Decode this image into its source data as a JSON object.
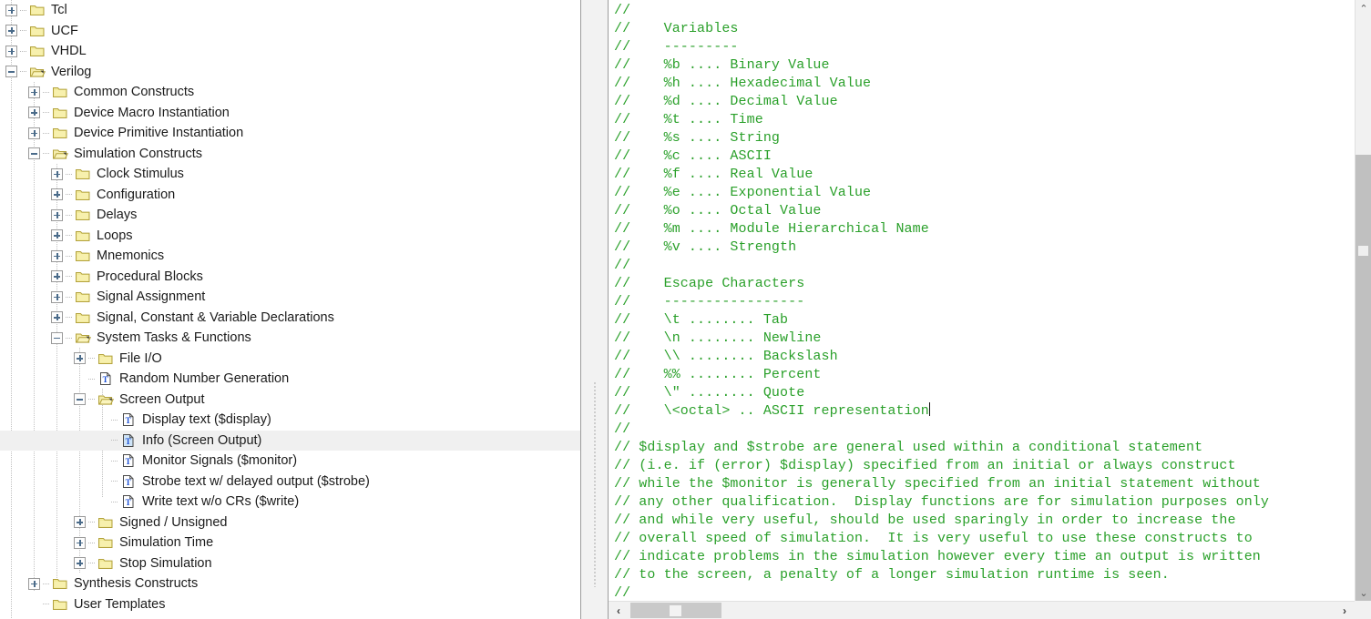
{
  "tree": {
    "name": "language-templates-tree",
    "items": [
      {
        "label": "Tcl",
        "depth": 0,
        "icon": "folder-closed-icon",
        "state": "collapsed"
      },
      {
        "label": "UCF",
        "depth": 0,
        "icon": "folder-closed-icon",
        "state": "collapsed"
      },
      {
        "label": "VHDL",
        "depth": 0,
        "icon": "folder-closed-icon",
        "state": "collapsed"
      },
      {
        "label": "Verilog",
        "depth": 0,
        "icon": "folder-open-icon",
        "state": "expanded"
      },
      {
        "label": "Common Constructs",
        "depth": 1,
        "icon": "folder-closed-icon",
        "state": "collapsed"
      },
      {
        "label": "Device Macro Instantiation",
        "depth": 1,
        "icon": "folder-closed-icon",
        "state": "collapsed"
      },
      {
        "label": "Device Primitive Instantiation",
        "depth": 1,
        "icon": "folder-closed-icon",
        "state": "collapsed"
      },
      {
        "label": "Simulation Constructs",
        "depth": 1,
        "icon": "folder-open-icon",
        "state": "expanded"
      },
      {
        "label": "Clock Stimulus",
        "depth": 2,
        "icon": "folder-closed-icon",
        "state": "collapsed"
      },
      {
        "label": "Configuration",
        "depth": 2,
        "icon": "folder-closed-icon",
        "state": "collapsed"
      },
      {
        "label": "Delays",
        "depth": 2,
        "icon": "folder-closed-icon",
        "state": "collapsed"
      },
      {
        "label": "Loops",
        "depth": 2,
        "icon": "folder-closed-icon",
        "state": "collapsed"
      },
      {
        "label": "Mnemonics",
        "depth": 2,
        "icon": "folder-closed-icon",
        "state": "collapsed"
      },
      {
        "label": "Procedural Blocks",
        "depth": 2,
        "icon": "folder-closed-icon",
        "state": "collapsed"
      },
      {
        "label": "Signal Assignment",
        "depth": 2,
        "icon": "folder-closed-icon",
        "state": "collapsed"
      },
      {
        "label": "Signal, Constant & Variable Declarations",
        "depth": 2,
        "icon": "folder-closed-icon",
        "state": "collapsed"
      },
      {
        "label": "System Tasks & Functions",
        "depth": 2,
        "icon": "folder-open-icon",
        "state": "expanded"
      },
      {
        "label": "File I/O",
        "depth": 3,
        "icon": "folder-closed-icon",
        "state": "collapsed"
      },
      {
        "label": "Random Number Generation",
        "depth": 3,
        "icon": "template-file-icon",
        "state": "leaf"
      },
      {
        "label": "Screen Output",
        "depth": 3,
        "icon": "folder-open-icon",
        "state": "expanded"
      },
      {
        "label": "Display text ($display)",
        "depth": 4,
        "icon": "template-file-icon",
        "state": "leaf"
      },
      {
        "label": "Info (Screen Output)",
        "depth": 4,
        "icon": "template-file-icon",
        "state": "leaf",
        "selected": true
      },
      {
        "label": "Monitor Signals ($monitor)",
        "depth": 4,
        "icon": "template-file-icon",
        "state": "leaf"
      },
      {
        "label": "Strobe text w/ delayed output ($strobe)",
        "depth": 4,
        "icon": "template-file-icon",
        "state": "leaf"
      },
      {
        "label": "Write text w/o CRs ($write)",
        "depth": 4,
        "icon": "template-file-icon",
        "state": "leaf"
      },
      {
        "label": "Signed / Unsigned",
        "depth": 3,
        "icon": "folder-closed-icon",
        "state": "collapsed"
      },
      {
        "label": "Simulation Time",
        "depth": 3,
        "icon": "folder-closed-icon",
        "state": "collapsed"
      },
      {
        "label": "Stop Simulation",
        "depth": 3,
        "icon": "folder-closed-icon",
        "state": "collapsed"
      },
      {
        "label": "Synthesis Constructs",
        "depth": 1,
        "icon": "folder-closed-icon",
        "state": "collapsed"
      },
      {
        "label": "User Templates",
        "depth": 1,
        "icon": "folder-closed-icon",
        "state": "leaf"
      }
    ]
  },
  "code": {
    "name": "template-preview",
    "language": "verilog",
    "comment_color": "#2aa02a",
    "caret_after_line": 22,
    "lines": [
      "//",
      "//    Variables",
      "//    ---------",
      "//    %b .... Binary Value",
      "//    %h .... Hexadecimal Value",
      "//    %d .... Decimal Value",
      "//    %t .... Time",
      "//    %s .... String",
      "//    %c .... ASCII",
      "//    %f .... Real Value",
      "//    %e .... Exponential Value",
      "//    %o .... Octal Value",
      "//    %m .... Module Hierarchical Name",
      "//    %v .... Strength",
      "//",
      "//    Escape Characters",
      "//    -----------------",
      "//    \\t ........ Tab",
      "//    \\n ........ Newline",
      "//    \\\\ ........ Backslash",
      "//    %% ........ Percent",
      "//    \\\" ........ Quote",
      "//    \\<octal> .. ASCII representation",
      "//",
      "// $display and $strobe are general used within a conditional statement",
      "// (i.e. if (error) $display) specified from an initial or always construct",
      "// while the $monitor is generally specified from an initial statement without",
      "// any other qualification.  Display functions are for simulation purposes only",
      "// and while very useful, should be used sparingly in order to increase the",
      "// overall speed of simulation.  It is very useful to use these constructs to",
      "// indicate problems in the simulation however every time an output is written",
      "// to the screen, a penalty of a longer simulation runtime is seen.",
      "//"
    ]
  },
  "scrollbars": {
    "vertical": {
      "name": "code-vertical-scrollbar",
      "up_arrow": "⌃",
      "down_arrow": "⌄"
    },
    "horizontal": {
      "name": "code-horizontal-scrollbar",
      "left_arrow": "‹",
      "right_arrow": "›"
    }
  },
  "splitter": {
    "name": "pane-splitter"
  }
}
